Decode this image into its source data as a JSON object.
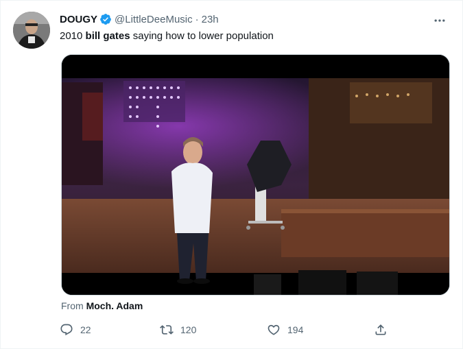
{
  "author": {
    "display_name": "DOUGY",
    "handle": "@LittleDeeMusic",
    "separator": "·",
    "time": "23h"
  },
  "tweet": {
    "text_before": "2010 ",
    "text_bold": "bill gates",
    "text_after": " saying how to lower population"
  },
  "media": {
    "source_prefix": "From ",
    "source_name": "Moch. Adam"
  },
  "actions": {
    "replies": "22",
    "retweets": "120",
    "likes": "194"
  },
  "icons": {
    "verified": "verified-badge-icon",
    "more": "more-options-icon",
    "reply": "reply-icon",
    "retweet": "retweet-icon",
    "like": "heart-icon",
    "share": "share-icon"
  },
  "colors": {
    "verified": "#1d9bf0",
    "secondary_text": "#536471",
    "primary_text": "#0f1419"
  }
}
